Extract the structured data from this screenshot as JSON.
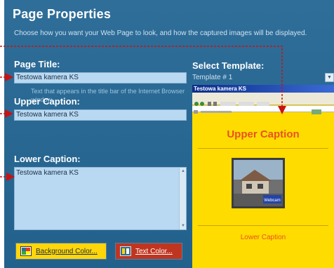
{
  "dialog": {
    "title": "Page Properties",
    "subtitle": "Choose how you want your Web Page to look, and how the captured images will be displayed."
  },
  "page_title": {
    "label": "Page Title:",
    "value": "Testowa kamera KS",
    "hint": "Text that appears in the title bar of the Internet Browser window."
  },
  "upper_caption": {
    "label": "Upper Caption:",
    "value": "Testowa kamera KS"
  },
  "lower_caption": {
    "label": "Lower Caption:",
    "value": "Testowa kamera KS"
  },
  "buttons": {
    "background_color": "Background Color...",
    "text_color": "Text Color..."
  },
  "template": {
    "label": "Select Template:",
    "selected": "Template # 1"
  },
  "preview": {
    "browser_title": "Testowa kamera KS",
    "upper_caption": "Upper Caption",
    "lower_caption": "Lower Caption",
    "photo_logo": "Webcam"
  },
  "colors": {
    "panel": "#2f6e99",
    "field": "#b9d9f2",
    "preview_bg": "#ffdc00",
    "caption": "#e8521e",
    "annotation_arrow": "#cc1111"
  },
  "icons": [
    "background-color-icon",
    "text-color-icon",
    "dropdown-arrow-icon",
    "scroll-up-arrow-icon",
    "scroll-down-arrow-icon"
  ]
}
